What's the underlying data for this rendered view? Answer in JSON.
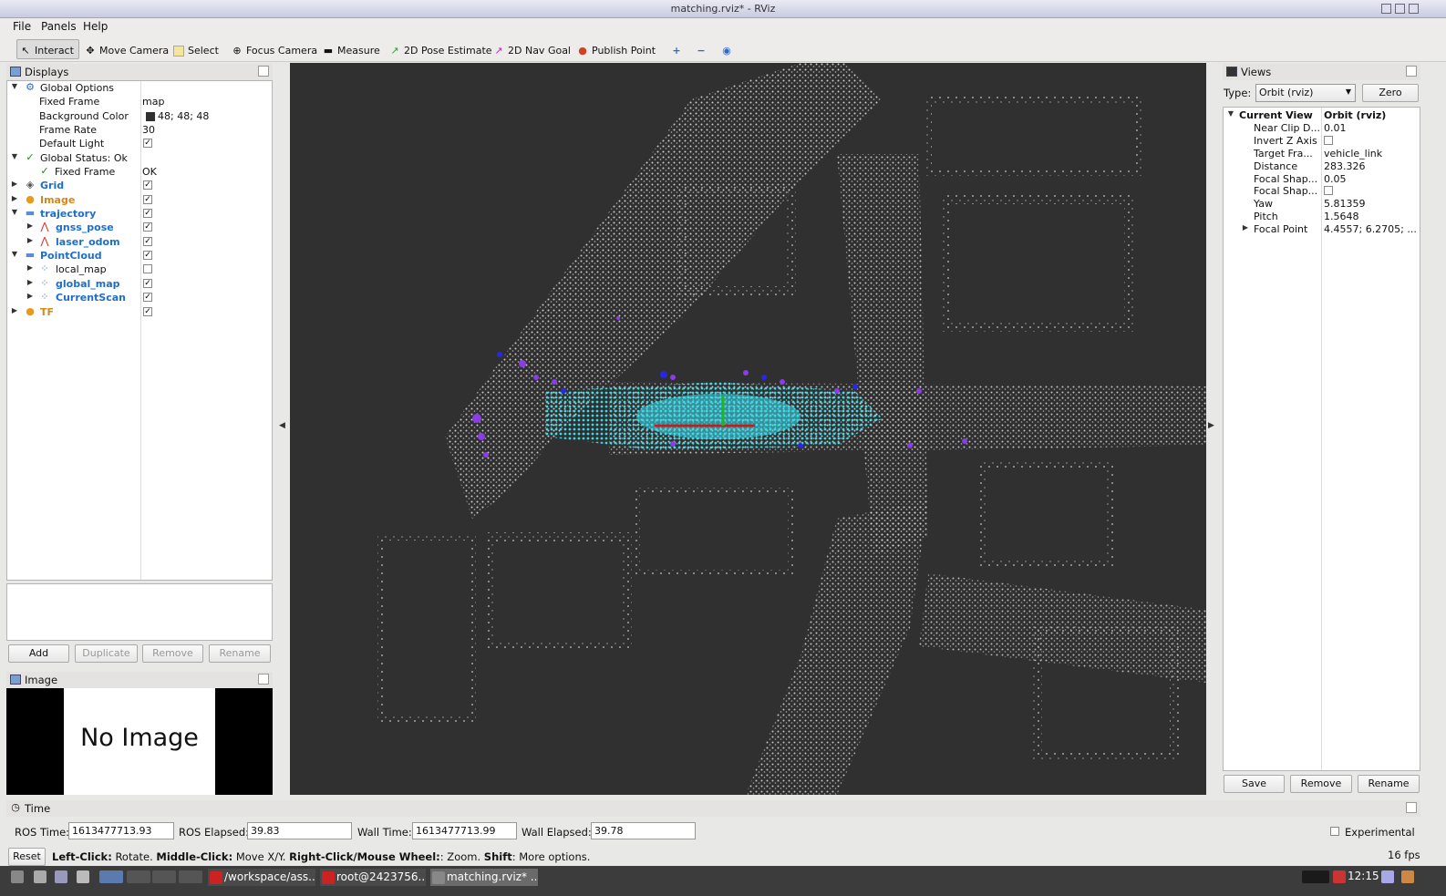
{
  "window": {
    "title": "matching.rviz* - RViz"
  },
  "menu": {
    "file": "File",
    "panels": "Panels",
    "help": "Help"
  },
  "toolbar": {
    "interact": "Interact",
    "move_camera": "Move Camera",
    "select": "Select",
    "focus_camera": "Focus Camera",
    "measure": "Measure",
    "pose_estimate": "2D Pose Estimate",
    "nav_goal": "2D Nav Goal",
    "publish_point": "Publish Point"
  },
  "displays": {
    "title": "Displays",
    "rows": [
      {
        "label": "Global Options"
      },
      {
        "label": "Fixed Frame",
        "value": "map"
      },
      {
        "label": "Background Color",
        "value": "48; 48; 48"
      },
      {
        "label": "Frame Rate",
        "value": "30"
      },
      {
        "label": "Default Light"
      },
      {
        "label": "Global Status: Ok"
      },
      {
        "label": "Fixed Frame",
        "value": "OK"
      },
      {
        "label": "Grid"
      },
      {
        "label": "Image"
      },
      {
        "label": "trajectory"
      },
      {
        "label": "gnss_pose"
      },
      {
        "label": "laser_odom"
      },
      {
        "label": "PointCloud"
      },
      {
        "label": "local_map"
      },
      {
        "label": "global_map"
      },
      {
        "label": "CurrentScan"
      },
      {
        "label": "TF"
      }
    ],
    "buttons": {
      "add": "Add",
      "duplicate": "Duplicate",
      "remove": "Remove",
      "rename": "Rename"
    }
  },
  "image_panel": {
    "title": "Image",
    "no_image": "No Image"
  },
  "views": {
    "title": "Views",
    "type_label": "Type:",
    "type_value": "Orbit (rviz)",
    "zero": "Zero",
    "rows": [
      {
        "label": "Current View",
        "value": "Orbit (rviz)"
      },
      {
        "label": "Near Clip D...",
        "value": "0.01"
      },
      {
        "label": "Invert Z Axis",
        "value": ""
      },
      {
        "label": "Target Fra...",
        "value": "vehicle_link"
      },
      {
        "label": "Distance",
        "value": "283.326"
      },
      {
        "label": "Focal Shap...",
        "value": "0.05"
      },
      {
        "label": "Focal Shap...",
        "value": ""
      },
      {
        "label": "Yaw",
        "value": "5.81359"
      },
      {
        "label": "Pitch",
        "value": "1.5648"
      },
      {
        "label": "Focal Point",
        "value": "4.4557; 6.2705; ..."
      }
    ],
    "buttons": {
      "save": "Save",
      "remove": "Remove",
      "rename": "Rename"
    }
  },
  "time": {
    "title": "Time",
    "ros_time_label": "ROS Time:",
    "ros_time": "1613477713.93",
    "ros_elapsed_label": "ROS Elapsed:",
    "ros_elapsed": "39.83",
    "wall_time_label": "Wall Time:",
    "wall_time": "1613477713.99",
    "wall_elapsed_label": "Wall Elapsed:",
    "wall_elapsed": "39.78",
    "experimental": "Experimental"
  },
  "status": {
    "reset": "Reset",
    "h1": "Left-Click:",
    "t1": " Rotate. ",
    "h2": "Middle-Click:",
    "t2": " Move X/Y. ",
    "h3": "Right-Click/Mouse Wheel:",
    "t3": ": Zoom. ",
    "h4": "Shift",
    "t4": ": More options.",
    "fps": "16 fps"
  },
  "taskbar": {
    "t1": "/workspace/ass...",
    "t2": "root@2423756...",
    "t3": "matching.rviz* ...",
    "clock": "12:15"
  },
  "colors": {
    "bg": "#303030",
    "scan": "#33e0f0",
    "global": "#d8d8d8",
    "purple": "#8a2be2"
  }
}
